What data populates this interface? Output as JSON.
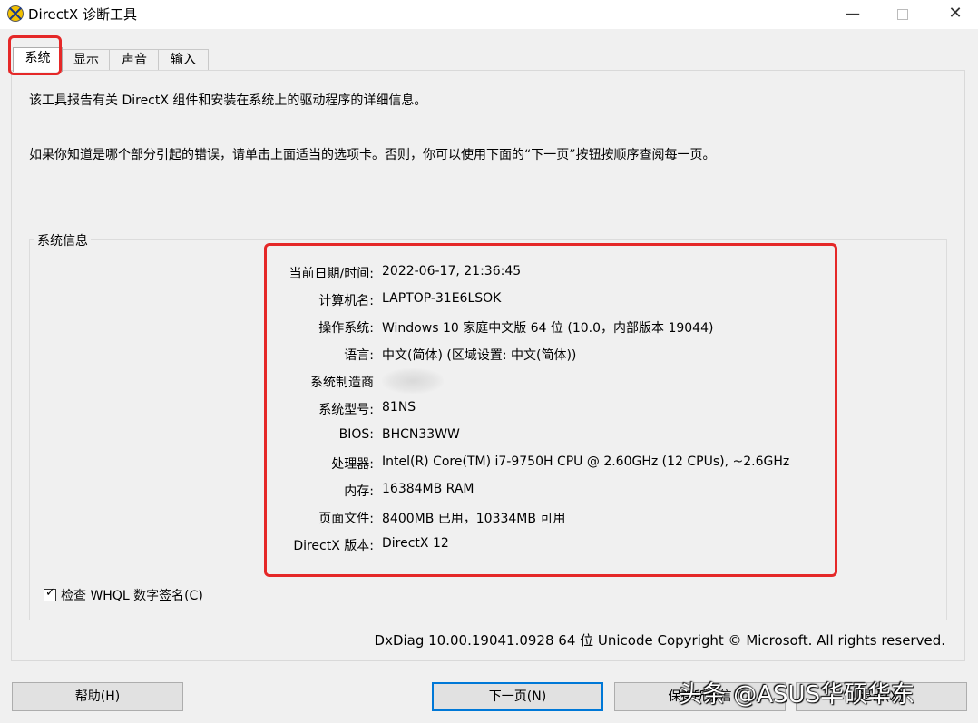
{
  "window": {
    "title": "DirectX 诊断工具",
    "minimize": "—",
    "close": "✕"
  },
  "tabs": [
    {
      "label": "系统"
    },
    {
      "label": "显示"
    },
    {
      "label": "声音"
    },
    {
      "label": "输入"
    }
  ],
  "intro": {
    "line1": "该工具报告有关 DirectX 组件和安装在系统上的驱动程序的详细信息。",
    "line2": "如果你知道是哪个部分引起的错误，请单击上面适当的选项卡。否则，你可以使用下面的“下一页”按钮按顺序查阅每一页。"
  },
  "system_info": {
    "group_title": "系统信息",
    "rows": [
      {
        "label": "当前日期/时间:",
        "value": "2022-06-17, 21:36:45"
      },
      {
        "label": "计算机名:",
        "value": "LAPTOP-31E6LSOK"
      },
      {
        "label": "操作系统:",
        "value": "Windows 10 家庭中文版 64 位 (10.0，内部版本 19044)"
      },
      {
        "label": "语言:",
        "value": "中文(简体) (区域设置: 中文(简体))"
      },
      {
        "label": "系统制造商",
        "value": ""
      },
      {
        "label": "系统型号:",
        "value": "81NS"
      },
      {
        "label": "BIOS:",
        "value": "BHCN33WW"
      },
      {
        "label": "处理器:",
        "value": "Intel(R) Core(TM) i7-9750H CPU @ 2.60GHz (12 CPUs), ~2.6GHz"
      },
      {
        "label": "内存:",
        "value": "16384MB RAM"
      },
      {
        "label": "页面文件:",
        "value": "8400MB 已用，10334MB 可用"
      },
      {
        "label": "DirectX 版本:",
        "value": "DirectX 12"
      }
    ]
  },
  "whql_check": {
    "label": "检查 WHQL 数字签名(C)",
    "checked": true
  },
  "footer": "DxDiag 10.00.19041.0928 64 位 Unicode  Copyright © Microsoft. All rights reserved.",
  "buttons": {
    "help": "帮助(H)",
    "next": "下一页(N)",
    "save": "保存所有信",
    "exit": "退出(X)"
  },
  "watermark": "头条 @ASUS华硕华东",
  "colors": {
    "highlight_box": "#e52828",
    "focus_button": "#0078d7"
  }
}
